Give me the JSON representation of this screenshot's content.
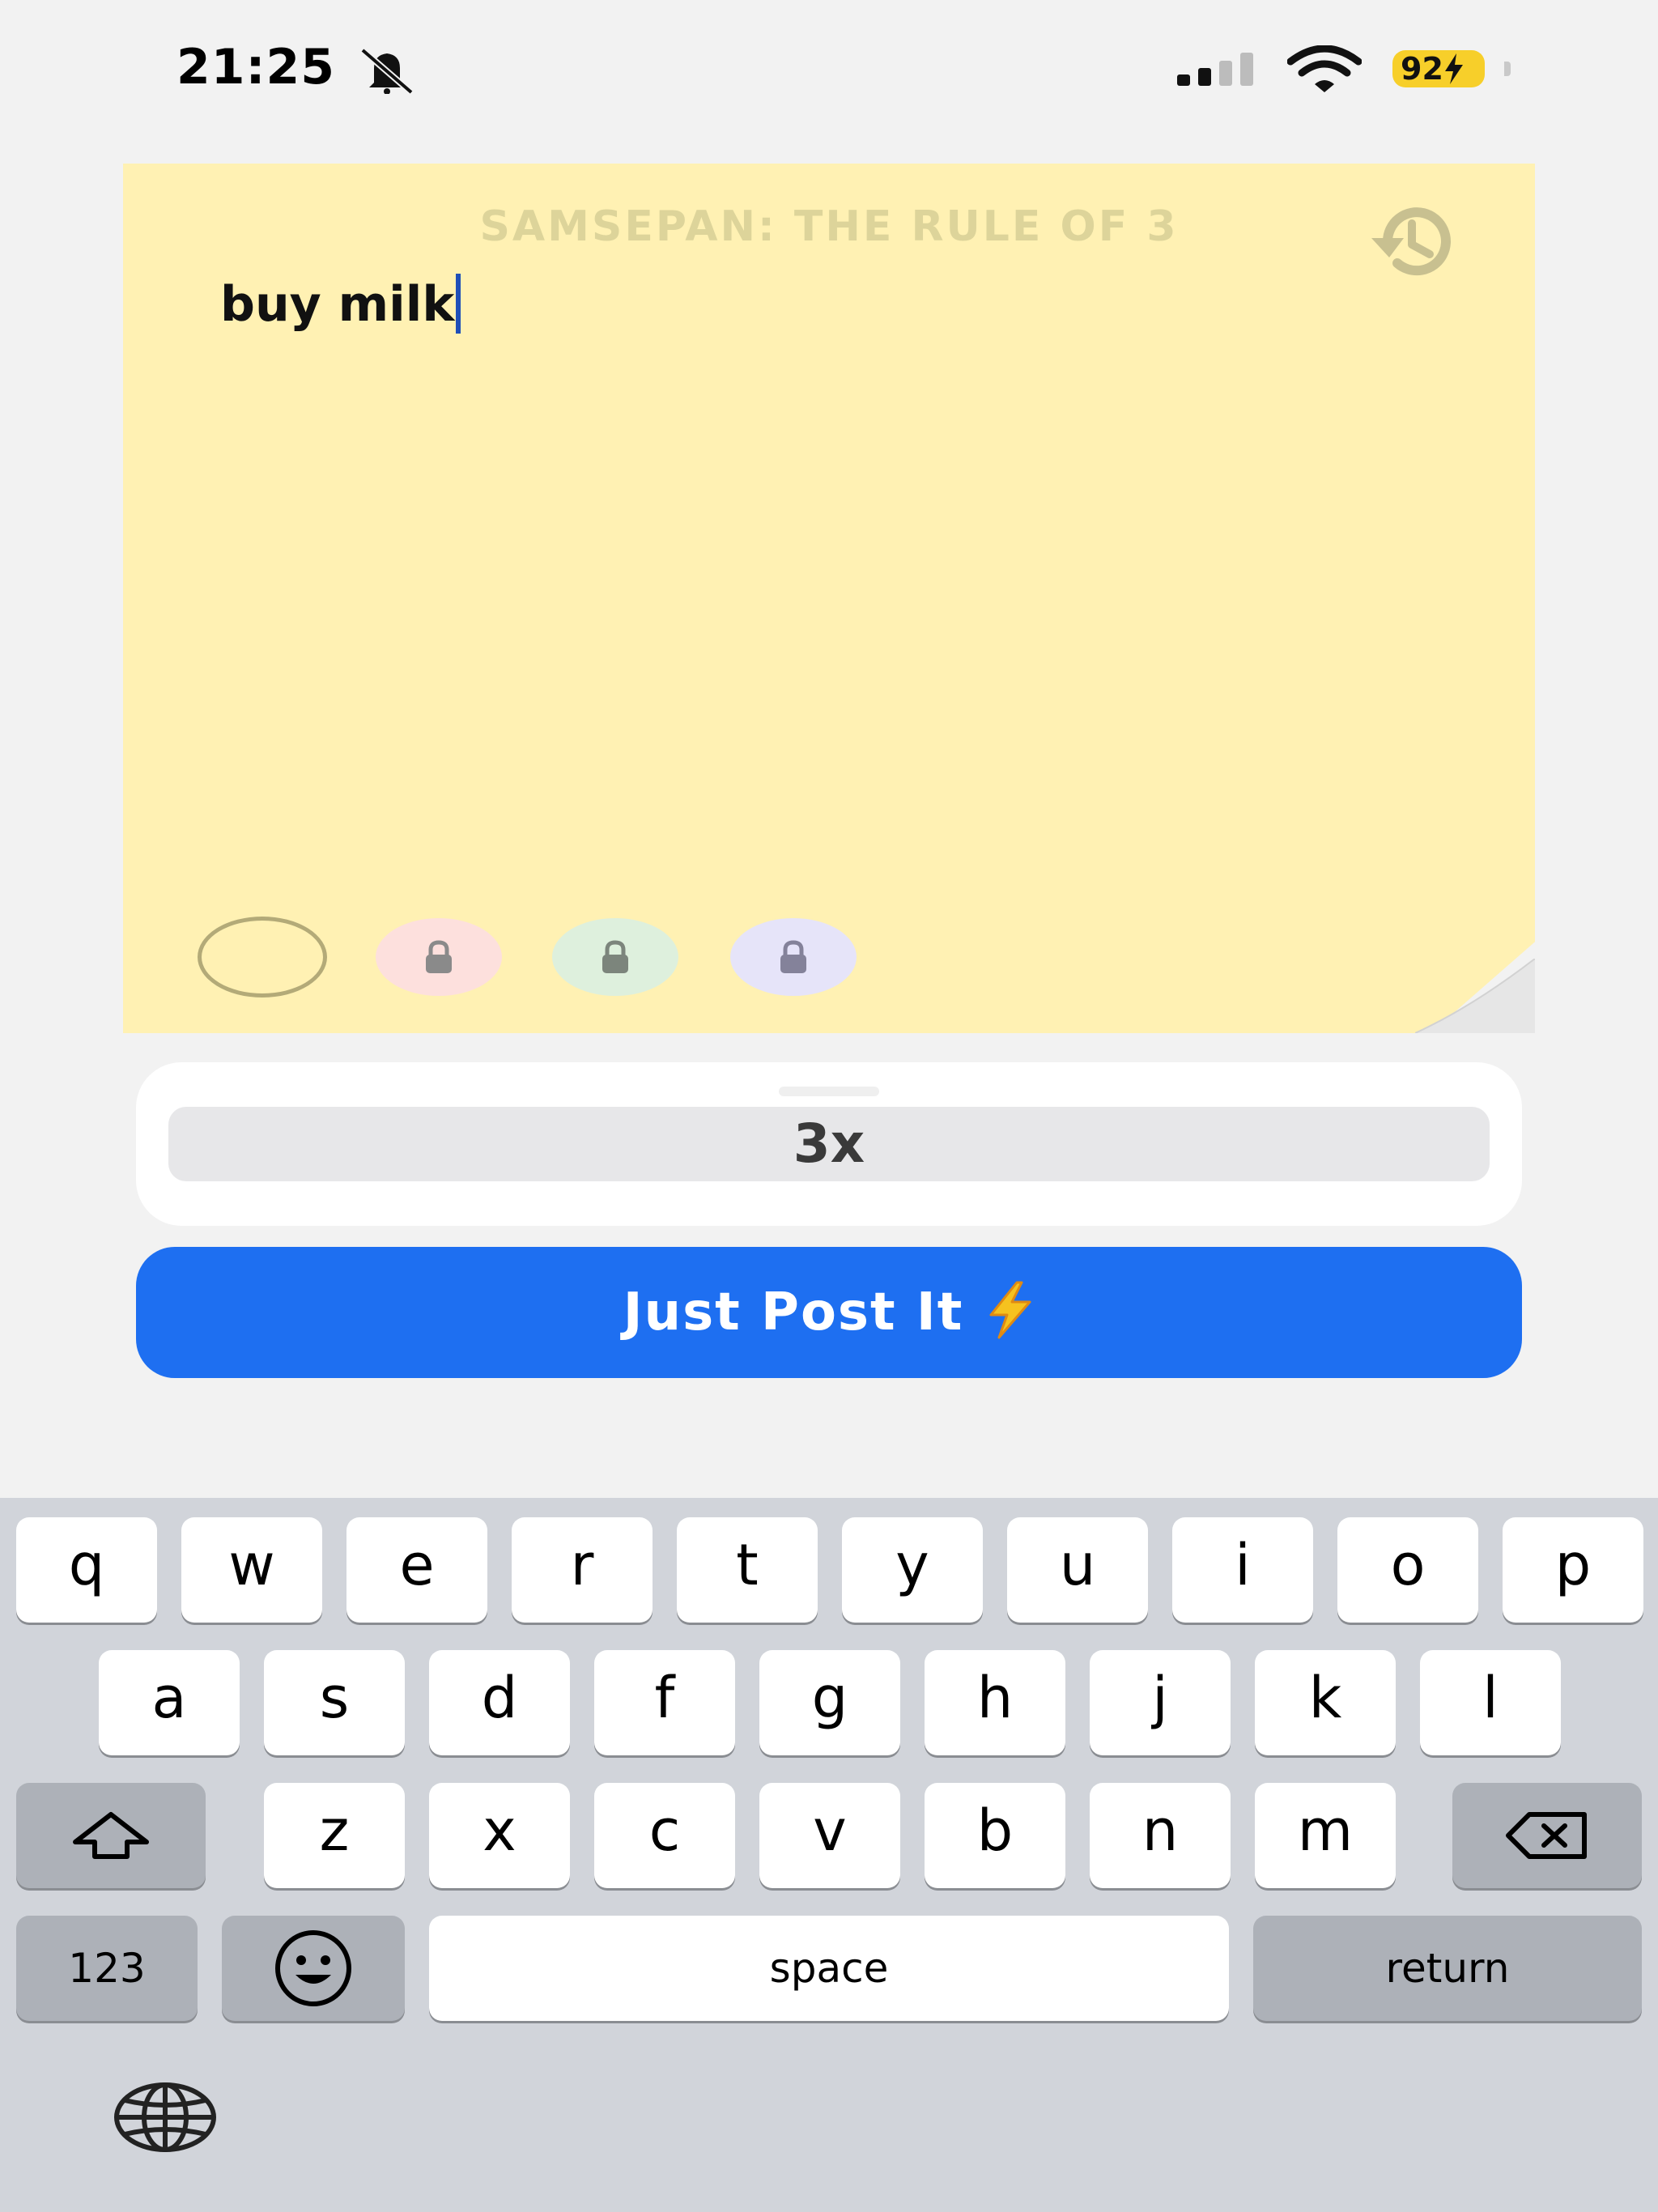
{
  "status_bar": {
    "time": "21:25",
    "battery": "92",
    "icons": [
      "bell-off-icon",
      "cellular-signal-icon",
      "wifi-icon",
      "battery-charging-icon"
    ]
  },
  "note": {
    "title": "SAMSEPAN: THE RULE OF 3",
    "text": "buy milk",
    "background_color": "#fff1b3",
    "colors": [
      {
        "name": "yellow",
        "color": "#fff1b3",
        "selected": true,
        "locked": false
      },
      {
        "name": "pink",
        "color": "#fde0dd",
        "selected": false,
        "locked": true
      },
      {
        "name": "green",
        "color": "#def0dd",
        "selected": false,
        "locked": true
      },
      {
        "name": "purple",
        "color": "#e6e4f9",
        "selected": false,
        "locked": true
      }
    ]
  },
  "multiplier": {
    "selected": "3x"
  },
  "post_button": {
    "label": "Just Post It",
    "color": "#1e6ff1",
    "icon": "lightning-bolt-icon"
  },
  "keyboard": {
    "row1": [
      "q",
      "w",
      "e",
      "r",
      "t",
      "y",
      "u",
      "i",
      "o",
      "p"
    ],
    "row2": [
      "a",
      "s",
      "d",
      "f",
      "g",
      "h",
      "j",
      "k",
      "l"
    ],
    "row3": [
      "z",
      "x",
      "c",
      "v",
      "b",
      "n",
      "m"
    ],
    "numbers_label": "123",
    "space_label": "space",
    "return_label": "return"
  }
}
